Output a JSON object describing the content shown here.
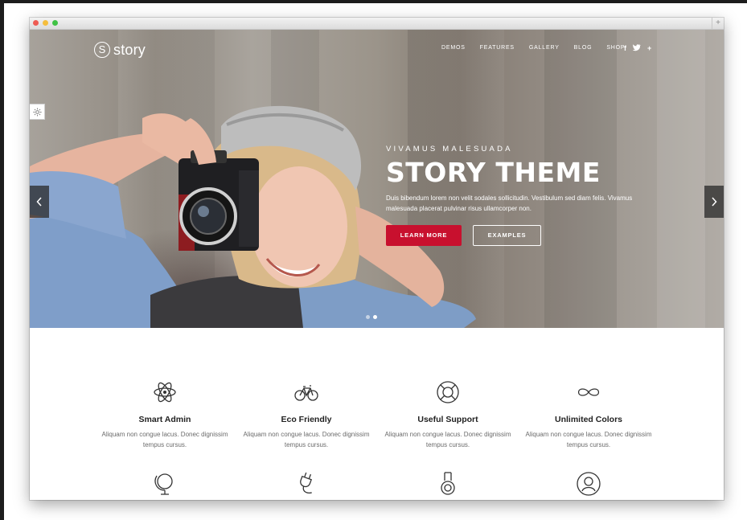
{
  "logo": {
    "mark": "S",
    "text": "story"
  },
  "nav": {
    "items": [
      "DEMOS",
      "FEATURES",
      "GALLERY",
      "BLOG",
      "SHOP"
    ],
    "social_icons": [
      "facebook-icon",
      "twitter-icon",
      "plus-icon"
    ],
    "social_glyphs": [
      "f",
      "♥",
      "+"
    ]
  },
  "hero": {
    "kicker": "VIVAMUS MALESUADA",
    "title": "STORY THEME",
    "text": "Duis bibendum lorem non velit sodales sollicitudin. Vestibulum sed diam felis. Vivamus malesuada placerat pulvinar risus ullamcorper non.",
    "primary_button": "LEARN MORE",
    "secondary_button": "EXAMPLES",
    "slides": 2,
    "active_slide": 2
  },
  "features": [
    {
      "icon": "atom-icon",
      "title": "Smart Admin",
      "text": "Aliquam non congue lacus. Donec dignissim tempus cursus."
    },
    {
      "icon": "bicycle-icon",
      "title": "Eco Friendly",
      "text": "Aliquam non congue lacus. Donec dignissim tempus cursus."
    },
    {
      "icon": "lifebuoy-icon",
      "title": "Useful Support",
      "text": "Aliquam non congue lacus. Donec dignissim tempus cursus."
    },
    {
      "icon": "infinity-icon",
      "title": "Unlimited Colors",
      "text": "Aliquam non congue lacus. Donec dignissim tempus cursus."
    }
  ],
  "features_row2_icons": [
    "globe-icon",
    "plug-icon",
    "medal-icon",
    "user-icon"
  ],
  "colors": {
    "accent": "#c8102e",
    "heading": "#222222",
    "body_text": "#6b6b6b"
  }
}
